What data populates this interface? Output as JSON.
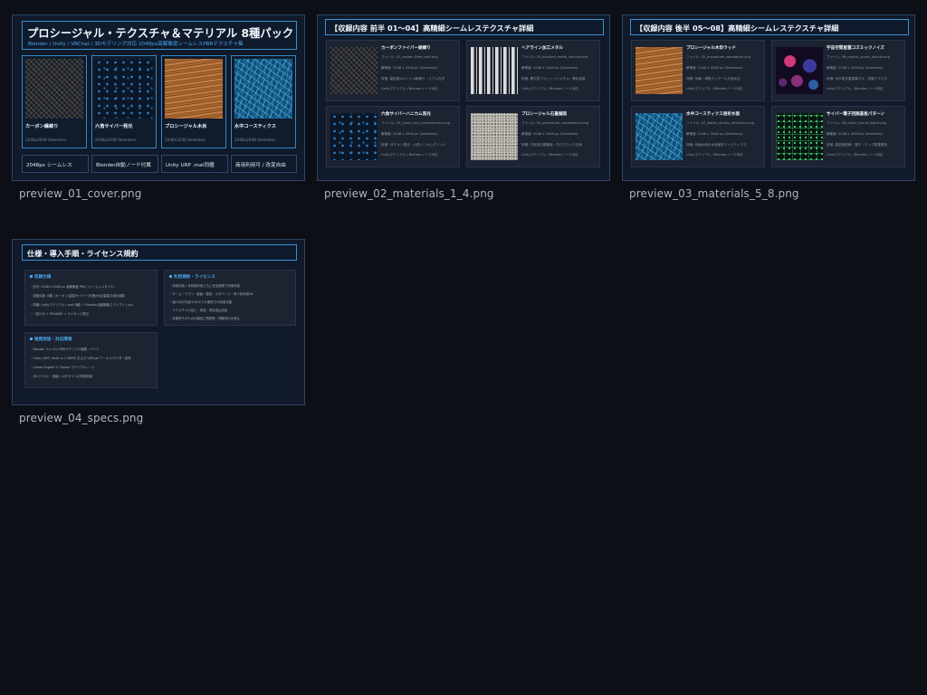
{
  "colors": {
    "background": "#0c0f15",
    "accent": "#49a8ec",
    "panel": "#1c2331",
    "border": "#3a8fd1"
  },
  "files": [
    {
      "caption": "preview_01_cover.png"
    },
    {
      "caption": "preview_02_materials_1_4.png"
    },
    {
      "caption": "preview_03_materials_5_8.png"
    },
    {
      "caption": "preview_04_specs.png"
    }
  ],
  "cover": {
    "title": "プロシージャル・テクスチャ＆マテリアル 8種パック",
    "subtitle": "Blender / Unity / VRChat / 3Dモデリング対応 2048px高解像度シームレスPBRテクスチャ集",
    "cards": [
      {
        "name": "カーボン繊維り",
        "res": "2048x2048 Seamless",
        "swatch": "carbon"
      },
      {
        "name": "六角サイバー発光",
        "res": "2048x2048 Seamless",
        "swatch": "hex"
      },
      {
        "name": "プロシージャル木目",
        "res": "2048x2048 Seamless",
        "swatch": "wood"
      },
      {
        "name": "水中コースティクス",
        "res": "2048x2048 Seamless",
        "swatch": "caustic"
      }
    ],
    "badges": [
      "2048px シームレス",
      "Blender自動ノード付属",
      "Unity URP .mat同梱",
      "商用利用可 / 改変自由"
    ]
  },
  "materials_1_4": {
    "title": "【収録内容 前半 01〜04】高精細シームレステクスチャ詳細",
    "items": [
      {
        "title": "カーボンファイバー綾織り",
        "file": "ファイル: 01_carbon_fiber_twill.png",
        "size": "解像度: 2048 x 2048 px (Seamless)",
        "feature": "特徴: 高密度2x2ツイル綾織り・リアル光沢",
        "compat": "Unityマテリアル / Blenderノード対応",
        "swatch": "carbon"
      },
      {
        "title": "ヘアライン加工メタル",
        "file": "ファイル: 02_brushed_metal_hairline.png",
        "size": "解像度: 2048 x 2048 px (Seamless)",
        "feature": "特徴: 異方性ブラッシュドメタル・異色金属",
        "compat": "Unityマテリアル / Blenderノード対応",
        "swatch": "brushed"
      },
      {
        "title": "六角サイバーハニカム発光",
        "file": "ファイル: 03_cyber_hex_luminescence.png",
        "size": "解像度: 2048 x 2048 px (Seamless)",
        "feature": "特徴: SFネオン発光・六角ハニカムグリッド",
        "compat": "Unityマテリアル / Blenderノード対応",
        "swatch": "hex"
      },
      {
        "title": "プロシージャル石畳舗装",
        "file": "ファイル: 04_procedural_cobblestone.png",
        "size": "解像度: 2048 x 2048 px (Seamless)",
        "feature": "特徴: 中世風石畳舗装・凹凸ブロック目地",
        "compat": "Unityマテリアル / Blenderノード対応",
        "swatch": "stone"
      }
    ]
  },
  "materials_5_8": {
    "title": "【収録内容 後半 05〜08】高精細シームレステクスチャ詳細",
    "items": [
      {
        "title": "プロシージャル木目ウッド",
        "file": "ファイル: 05_procedural_woodgrain.png",
        "size": "解像度: 2048 x 2048 px (Seamless)",
        "feature": "特徴: 年輪・導管ディテール天然木目",
        "compat": "Unityマテリアル / Blenderノード対応",
        "swatch": "wood"
      },
      {
        "title": "宇宙空間星雲コズミックノイズ",
        "file": "ファイル: 06_cosmic_space_nebula.png",
        "size": "解像度: 2048 x 2048 px (Seamless)",
        "feature": "特徴: 深宇宙多重星雲ガス・恒星クラスタ",
        "compat": "Unityマテリアル / Blenderノード対応",
        "swatch": "nebula"
      },
      {
        "title": "水中コースティクス屈折水面",
        "file": "ファイル: 07_water_caustic_refraction.png",
        "size": "解像度: 2048 x 2048 px (Seamless)",
        "feature": "特徴: 光線水面の水底屈折コースティクス",
        "compat": "Unityマテリアル / Blenderノード対応",
        "swatch": "caustic"
      },
      {
        "title": "サイバー電子回路基板パターン",
        "file": "ファイル: 08_cyber_circuit_board.png",
        "size": "解像度: 2048 x 2048 px (Seamless)",
        "feature": "特徴: 高密度配線・端子・チップ配置基板",
        "compat": "Unityマテリアル / Blenderノード対応",
        "swatch": "circuit"
      }
    ]
  },
  "specs": {
    "title": "仕様・導入手順・ライセンス規約",
    "sections": [
      {
        "heading": "収録仕様",
        "lines": [
          "・形式: 2048 x 2048 px 高解像度 PNG（シームレスタイル）",
          "・収録点数: 8種（カーボン/金属/サイバー/石畳/木目/星雲/水面/回路）",
          "・同梱: Unityマテリアル (.mat 8種) + Blender自動構築スクリプト (.py)",
          "・一覧CSV + README + ライセンス表示"
        ]
      },
      {
        "heading": "利用規約・ライセンス",
        "lines": [
          "・商用利用 / 非商用利用ともに完全無償で利用可能",
          "・ゲーム・アプリ・動画・配信・メタバース・同人誌利用OK",
          "・個人向け作品や3Dモデル販売での利用可能",
          "・テクスチャの加工・改変・再合成は自由",
          "・本素材そのものの無加工再配布・再販売のみ禁止"
        ]
      },
      {
        "heading": "推奨用途・対応環境",
        "lines": [
          "・Blender 3.x / 4.x PBRマテリアル構築・ベイク",
          "・Unity (URP / Built-in / HDRP) および VRChat ワールド/アバター制作",
          "・Unreal Engine 5 / Godot マテリアルノード",
          "・2Dイラスト・漫画・UIデザインの質感背景"
        ]
      }
    ]
  }
}
